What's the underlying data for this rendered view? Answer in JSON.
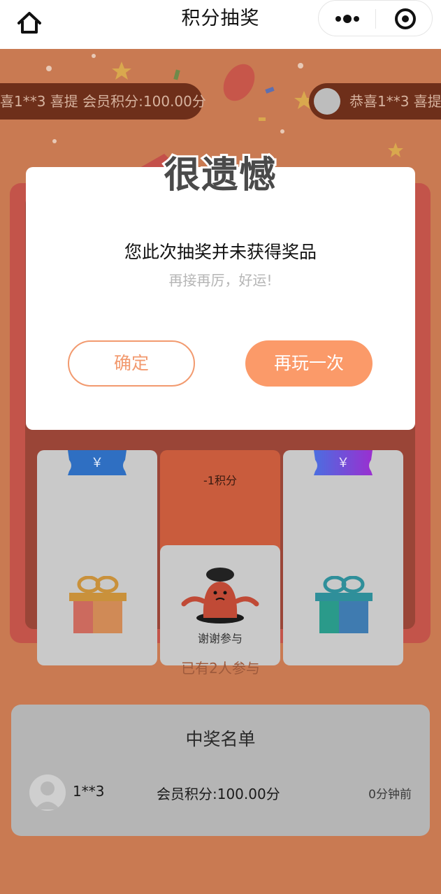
{
  "navbar": {
    "title": "积分抽奖",
    "home_icon": "home-icon",
    "more_icon": "more-dots-icon",
    "close_icon": "target-circle-icon"
  },
  "tickers": [
    {
      "text": "喜1**3 喜提 会员积分:100.00分"
    },
    {
      "text": "恭喜1**3 喜提"
    }
  ],
  "grid": {
    "center_top_label": "-1积分",
    "center_bottom_label": "谢谢参与"
  },
  "participants_text": "已有2人参与",
  "winners": {
    "title": "中奖名单",
    "rows": [
      {
        "name": "1**3",
        "prize": "会员积分:100.00分",
        "time": "0分钟前"
      }
    ]
  },
  "modal": {
    "title": "很遗憾",
    "message": "您此次抽奖并未获得奖品",
    "sub": "再接再厉，好运!",
    "confirm_label": "确定",
    "again_label": "再玩一次"
  },
  "colors": {
    "accent": "#fb9a69",
    "background": "#c97a52",
    "board": "#c3544a"
  }
}
